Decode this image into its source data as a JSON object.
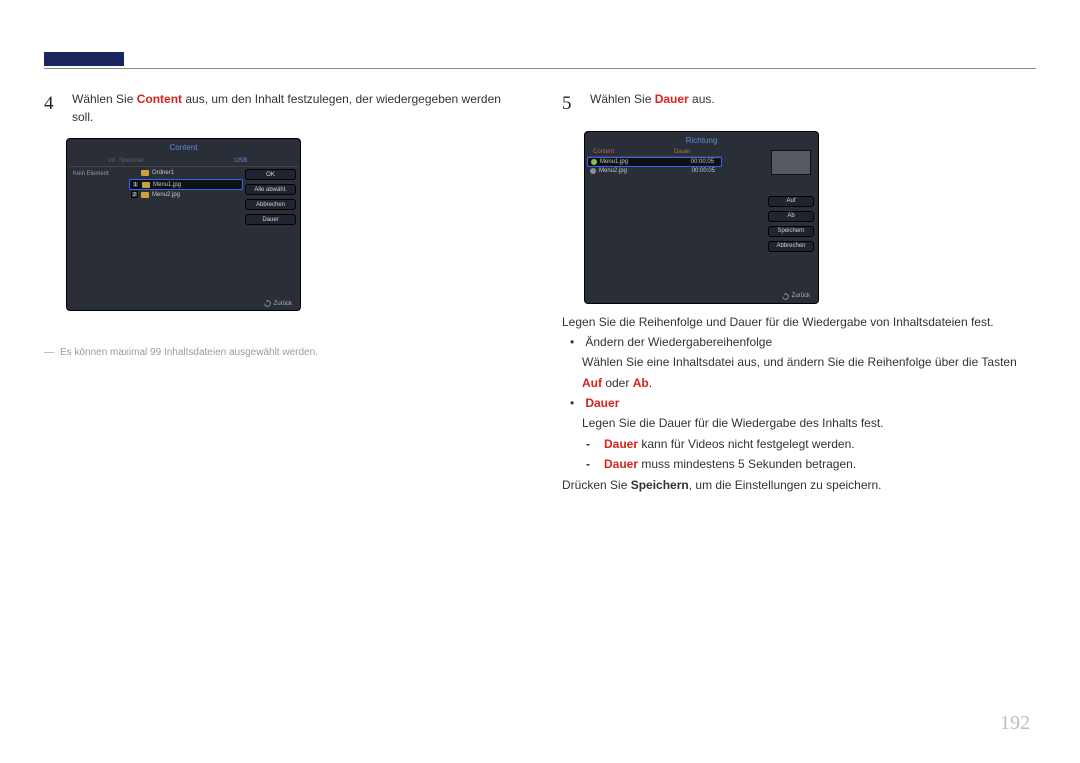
{
  "page_number": "192",
  "left": {
    "step_number": "4",
    "step_text_pre": "Wählen Sie ",
    "step_text_hl": "Content",
    "step_text_post": " aus, um den Inhalt festzulegen, der wiedergegeben werden soll.",
    "footnote": "Es können maximal 99 Inhaltsdateien ausgewählt werden.",
    "device": {
      "title": "Content",
      "tab_left": "Int. Speicher",
      "tab_right": "USB",
      "left_pane": "Kein Element",
      "row_folder": "Ordner1",
      "row1_num": "1",
      "row1_name": "Menu1.jpg",
      "row2_num": "2",
      "row2_name": "Menu2.jpg",
      "btn1": "OK",
      "btn2": "Alle abwähl.",
      "btn3": "Abbrechen",
      "btn4": "Dauer",
      "back": "Zurück"
    }
  },
  "right": {
    "step_number": "5",
    "step_text_pre": "Wählen Sie ",
    "step_text_hl": "Dauer",
    "step_text_post": " aus.",
    "device": {
      "title": "Richtung",
      "tab_left": "Content",
      "tab_right": "Dauer",
      "row1_name": "Menu1.jpg",
      "row1_dur": "00:00:05",
      "row2_name": "Menu2.jpg",
      "row2_dur": "00:00:05",
      "btn1": "Auf",
      "btn2": "Ab",
      "btn3": "Speichern",
      "btn4": "Abbrechen",
      "back": "Zurück"
    },
    "p1": "Legen Sie die Reihenfolge und Dauer für die Wiedergabe von Inhaltsdateien fest.",
    "li1_title": "Ändern der Wiedergabereihenfolge",
    "li1_desc_pre": "Wählen Sie eine Inhaltsdatei aus, und ändern Sie die Reihenfolge über die Tasten ",
    "li1_hl1": "Auf",
    "li1_mid": " oder ",
    "li1_hl2": "Ab",
    "li1_post": ".",
    "li2_title": "Dauer",
    "li2_desc": "Legen Sie die Dauer für die Wiedergabe des Inhalts fest.",
    "sub1_hl": "Dauer",
    "sub1_post": " kann für Videos nicht festgelegt werden.",
    "sub2_hl": "Dauer",
    "sub2_post": " muss mindestens 5 Sekunden betragen.",
    "p2_pre": "Drücken Sie ",
    "p2_hl": "Speichern",
    "p2_post": ", um die Einstellungen zu speichern."
  }
}
